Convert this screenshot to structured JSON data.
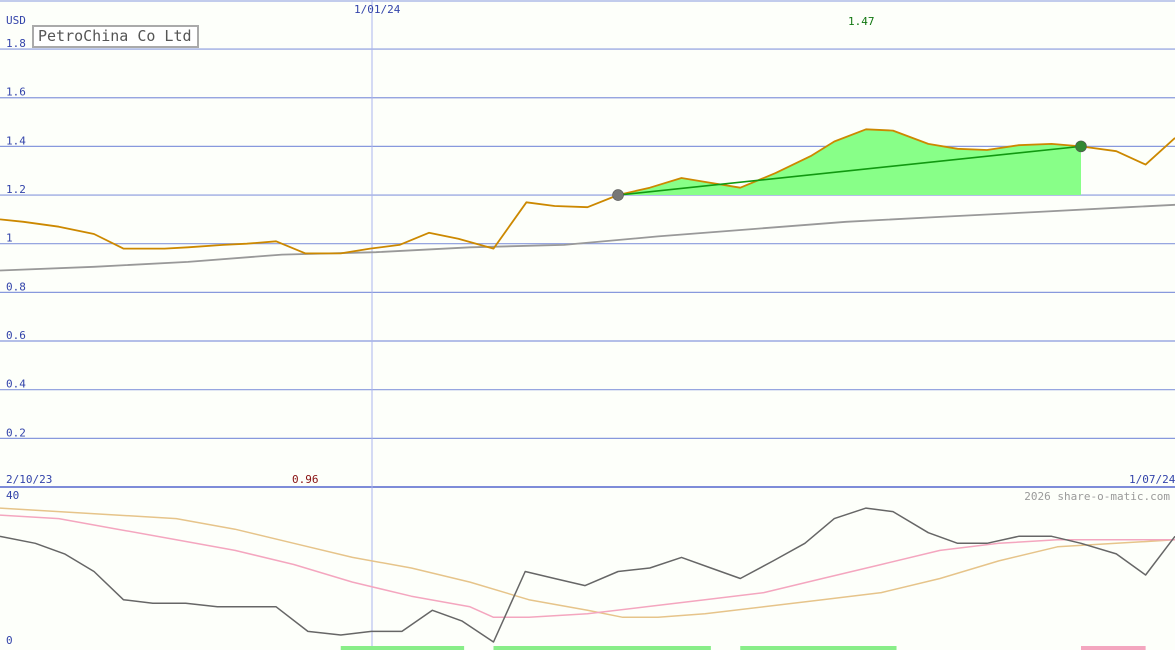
{
  "chart_data": [
    {
      "type": "line",
      "title": "PetroChina Co Ltd",
      "currency_label": "USD",
      "ylim": [
        0,
        1.9
      ],
      "y_ticks": [
        "1.8",
        "1.6",
        "1.4",
        "1.2",
        "1",
        "0.8",
        "0.6",
        "0.4",
        "0.2"
      ],
      "date_start": "2/10/23",
      "date_mid": "1/01/24",
      "date_end": "1/07/24",
      "high_label": "1.47",
      "low_label": "0.96",
      "grid": true,
      "series": [
        {
          "role": "price",
          "color": "#cc8800",
          "x": [
            0,
            0.02,
            0.05,
            0.08,
            0.105,
            0.14,
            0.16,
            0.19,
            0.21,
            0.235,
            0.26,
            0.29,
            0.315,
            0.34,
            0.365,
            0.39,
            0.42,
            0.448,
            0.472,
            0.5,
            0.526,
            0.553,
            0.58,
            0.605,
            0.63,
            0.66,
            0.69,
            0.71,
            0.737,
            0.76,
            0.79,
            0.815,
            0.84,
            0.867,
            0.895,
            0.92,
            0.95,
            0.975,
            1.0
          ],
          "values": [
            1.1,
            1.09,
            1.07,
            1.04,
            0.98,
            0.98,
            0.985,
            0.995,
            1.0,
            1.01,
            0.96,
            0.96,
            0.98,
            0.995,
            1.045,
            1.02,
            0.98,
            1.17,
            1.155,
            1.15,
            1.2,
            1.23,
            1.27,
            1.25,
            1.23,
            1.29,
            1.36,
            1.42,
            1.47,
            1.465,
            1.41,
            1.39,
            1.385,
            1.405,
            1.41,
            1.4,
            1.38,
            1.325,
            1.435
          ]
        },
        {
          "role": "moving-average",
          "color": "#999999",
          "x": [
            0,
            0.08,
            0.16,
            0.24,
            0.32,
            0.4,
            0.48,
            0.56,
            0.64,
            0.72,
            0.8,
            0.88,
            0.96,
            1.0
          ],
          "values": [
            0.89,
            0.905,
            0.925,
            0.955,
            0.965,
            0.985,
            0.995,
            1.03,
            1.06,
            1.09,
            1.11,
            1.13,
            1.15,
            1.16
          ]
        }
      ],
      "trend_line": {
        "x": [
          0.526,
          0.92
        ],
        "values": [
          1.2,
          1.4
        ],
        "color": "#119911"
      },
      "shaded_range": {
        "x_start": 0.526,
        "x_end": 0.92,
        "base": 1.2,
        "color": "#88ff88"
      },
      "markers": [
        {
          "x": 0.526,
          "value": 1.2,
          "color": "#777777"
        },
        {
          "x": 0.92,
          "value": 1.4,
          "color": "#338833"
        }
      ]
    },
    {
      "type": "line",
      "ylim": [
        0,
        40
      ],
      "y_ticks": [
        "40",
        "0"
      ],
      "copyright": "2026 share-o-matic.com",
      "grid": false,
      "series": [
        {
          "role": "oscillator",
          "color": "#666666",
          "x": [
            0,
            0.03,
            0.055,
            0.08,
            0.105,
            0.13,
            0.158,
            0.185,
            0.21,
            0.235,
            0.262,
            0.29,
            0.316,
            0.342,
            0.368,
            0.393,
            0.42,
            0.447,
            0.472,
            0.498,
            0.526,
            0.553,
            0.58,
            0.605,
            0.63,
            0.658,
            0.685,
            0.71,
            0.737,
            0.76,
            0.79,
            0.815,
            0.84,
            0.867,
            0.895,
            0.92,
            0.95,
            0.975,
            1.0
          ],
          "values": [
            30,
            28,
            25,
            20,
            12,
            11,
            11,
            10,
            10,
            10,
            3,
            2,
            3,
            3,
            9,
            6,
            0,
            20,
            18,
            16,
            20,
            21,
            24,
            21,
            18,
            23,
            28,
            35,
            38,
            37,
            31,
            28,
            28,
            30,
            30,
            28,
            25,
            19,
            30
          ]
        },
        {
          "role": "signal-fast",
          "color": "#f4a6bf",
          "x": [
            0,
            0.05,
            0.1,
            0.15,
            0.2,
            0.25,
            0.3,
            0.35,
            0.4,
            0.42,
            0.45,
            0.5,
            0.55,
            0.6,
            0.65,
            0.7,
            0.75,
            0.8,
            0.85,
            0.9,
            0.95,
            1.0
          ],
          "values": [
            36,
            35,
            32,
            29,
            26,
            22,
            17,
            13,
            10,
            7,
            7,
            8,
            10,
            12,
            14,
            18,
            22,
            26,
            28,
            29,
            29,
            29
          ]
        },
        {
          "role": "signal-slow",
          "color": "#e6c48a",
          "x": [
            0,
            0.05,
            0.1,
            0.15,
            0.2,
            0.25,
            0.3,
            0.35,
            0.4,
            0.45,
            0.5,
            0.53,
            0.56,
            0.6,
            0.65,
            0.7,
            0.75,
            0.8,
            0.85,
            0.9,
            0.95,
            1.0
          ],
          "values": [
            38,
            37,
            36,
            35,
            32,
            28,
            24,
            21,
            17,
            12,
            9,
            7,
            7,
            8,
            10,
            12,
            14,
            18,
            23,
            27,
            28,
            29
          ]
        }
      ],
      "volume_bars": [
        {
          "x_start": 0.29,
          "x_end": 0.395,
          "color": "#88ee88"
        },
        {
          "x_start": 0.42,
          "x_end": 0.605,
          "color": "#88ee88"
        },
        {
          "x_start": 0.527,
          "x_end": 0.58,
          "color": "#88ee88"
        },
        {
          "x_start": 0.63,
          "x_end": 0.763,
          "color": "#88ee88"
        },
        {
          "x_start": 0.92,
          "x_end": 0.975,
          "color": "#f4a6bf"
        }
      ]
    }
  ]
}
